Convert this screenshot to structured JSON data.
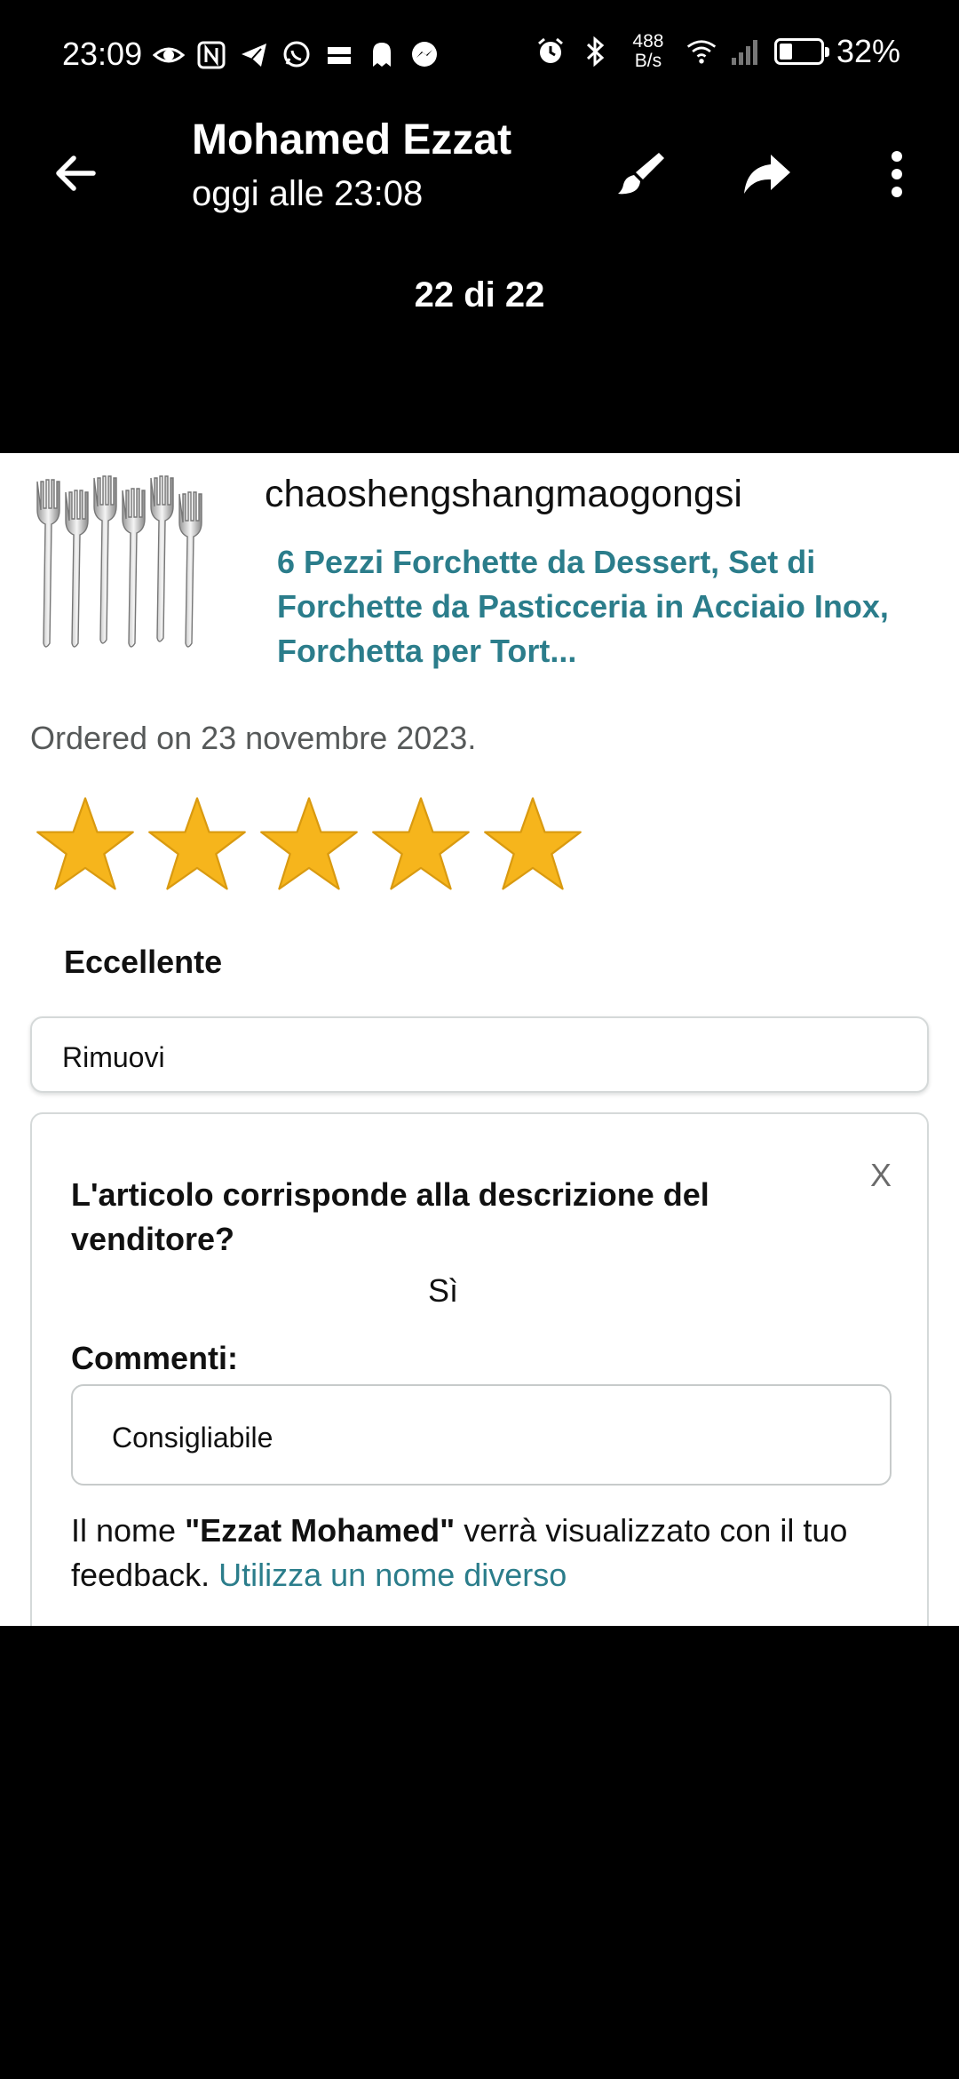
{
  "status_bar": {
    "time": "23:09",
    "net_speed_value": "488",
    "net_speed_unit": "B/s",
    "battery_percent": "32%",
    "battery_level": 0.32,
    "icons": [
      "eye-icon",
      "nfc-icon",
      "telegram-icon",
      "whatsapp-icon",
      "temu-icon",
      "ghost-icon",
      "messenger-icon",
      "alarm-icon",
      "bluetooth-icon",
      "wifi-icon",
      "signal-icon",
      "battery-icon"
    ]
  },
  "header": {
    "sender": "Mohamed Ezzat",
    "timestamp": "oggi alle 23:08",
    "counter": "22 di 22",
    "actions": [
      "back-icon",
      "brush-icon",
      "share-icon",
      "more-icon"
    ]
  },
  "review": {
    "seller": "chaoshengshangmaogongsi",
    "product_title": "6 Pezzi Forchette da Dessert, Set di Forchette da Pasticceria in Acciaio Inox, Forchetta per Tort...",
    "order_date": "Ordered on 23 novembre 2023.",
    "rating": 5,
    "rating_max": 5,
    "rating_label": "Eccellente",
    "remove_label": "Rimuovi",
    "star_color": "#f6b51c",
    "link_color": "#2b7d8b",
    "feedback": {
      "close": "X",
      "question": "L'articolo corrisponde alla descrizione del venditore?",
      "answer": "Sì",
      "comments_label": "Commenti:",
      "comment_value": "Consigliabile",
      "note_prefix": "Il nome ",
      "note_name": "\"Ezzat Mohamed\"",
      "note_suffix": " verrà visualizzato con il tuo feedback. ",
      "note_link": "Utilizza un nome diverso"
    }
  }
}
